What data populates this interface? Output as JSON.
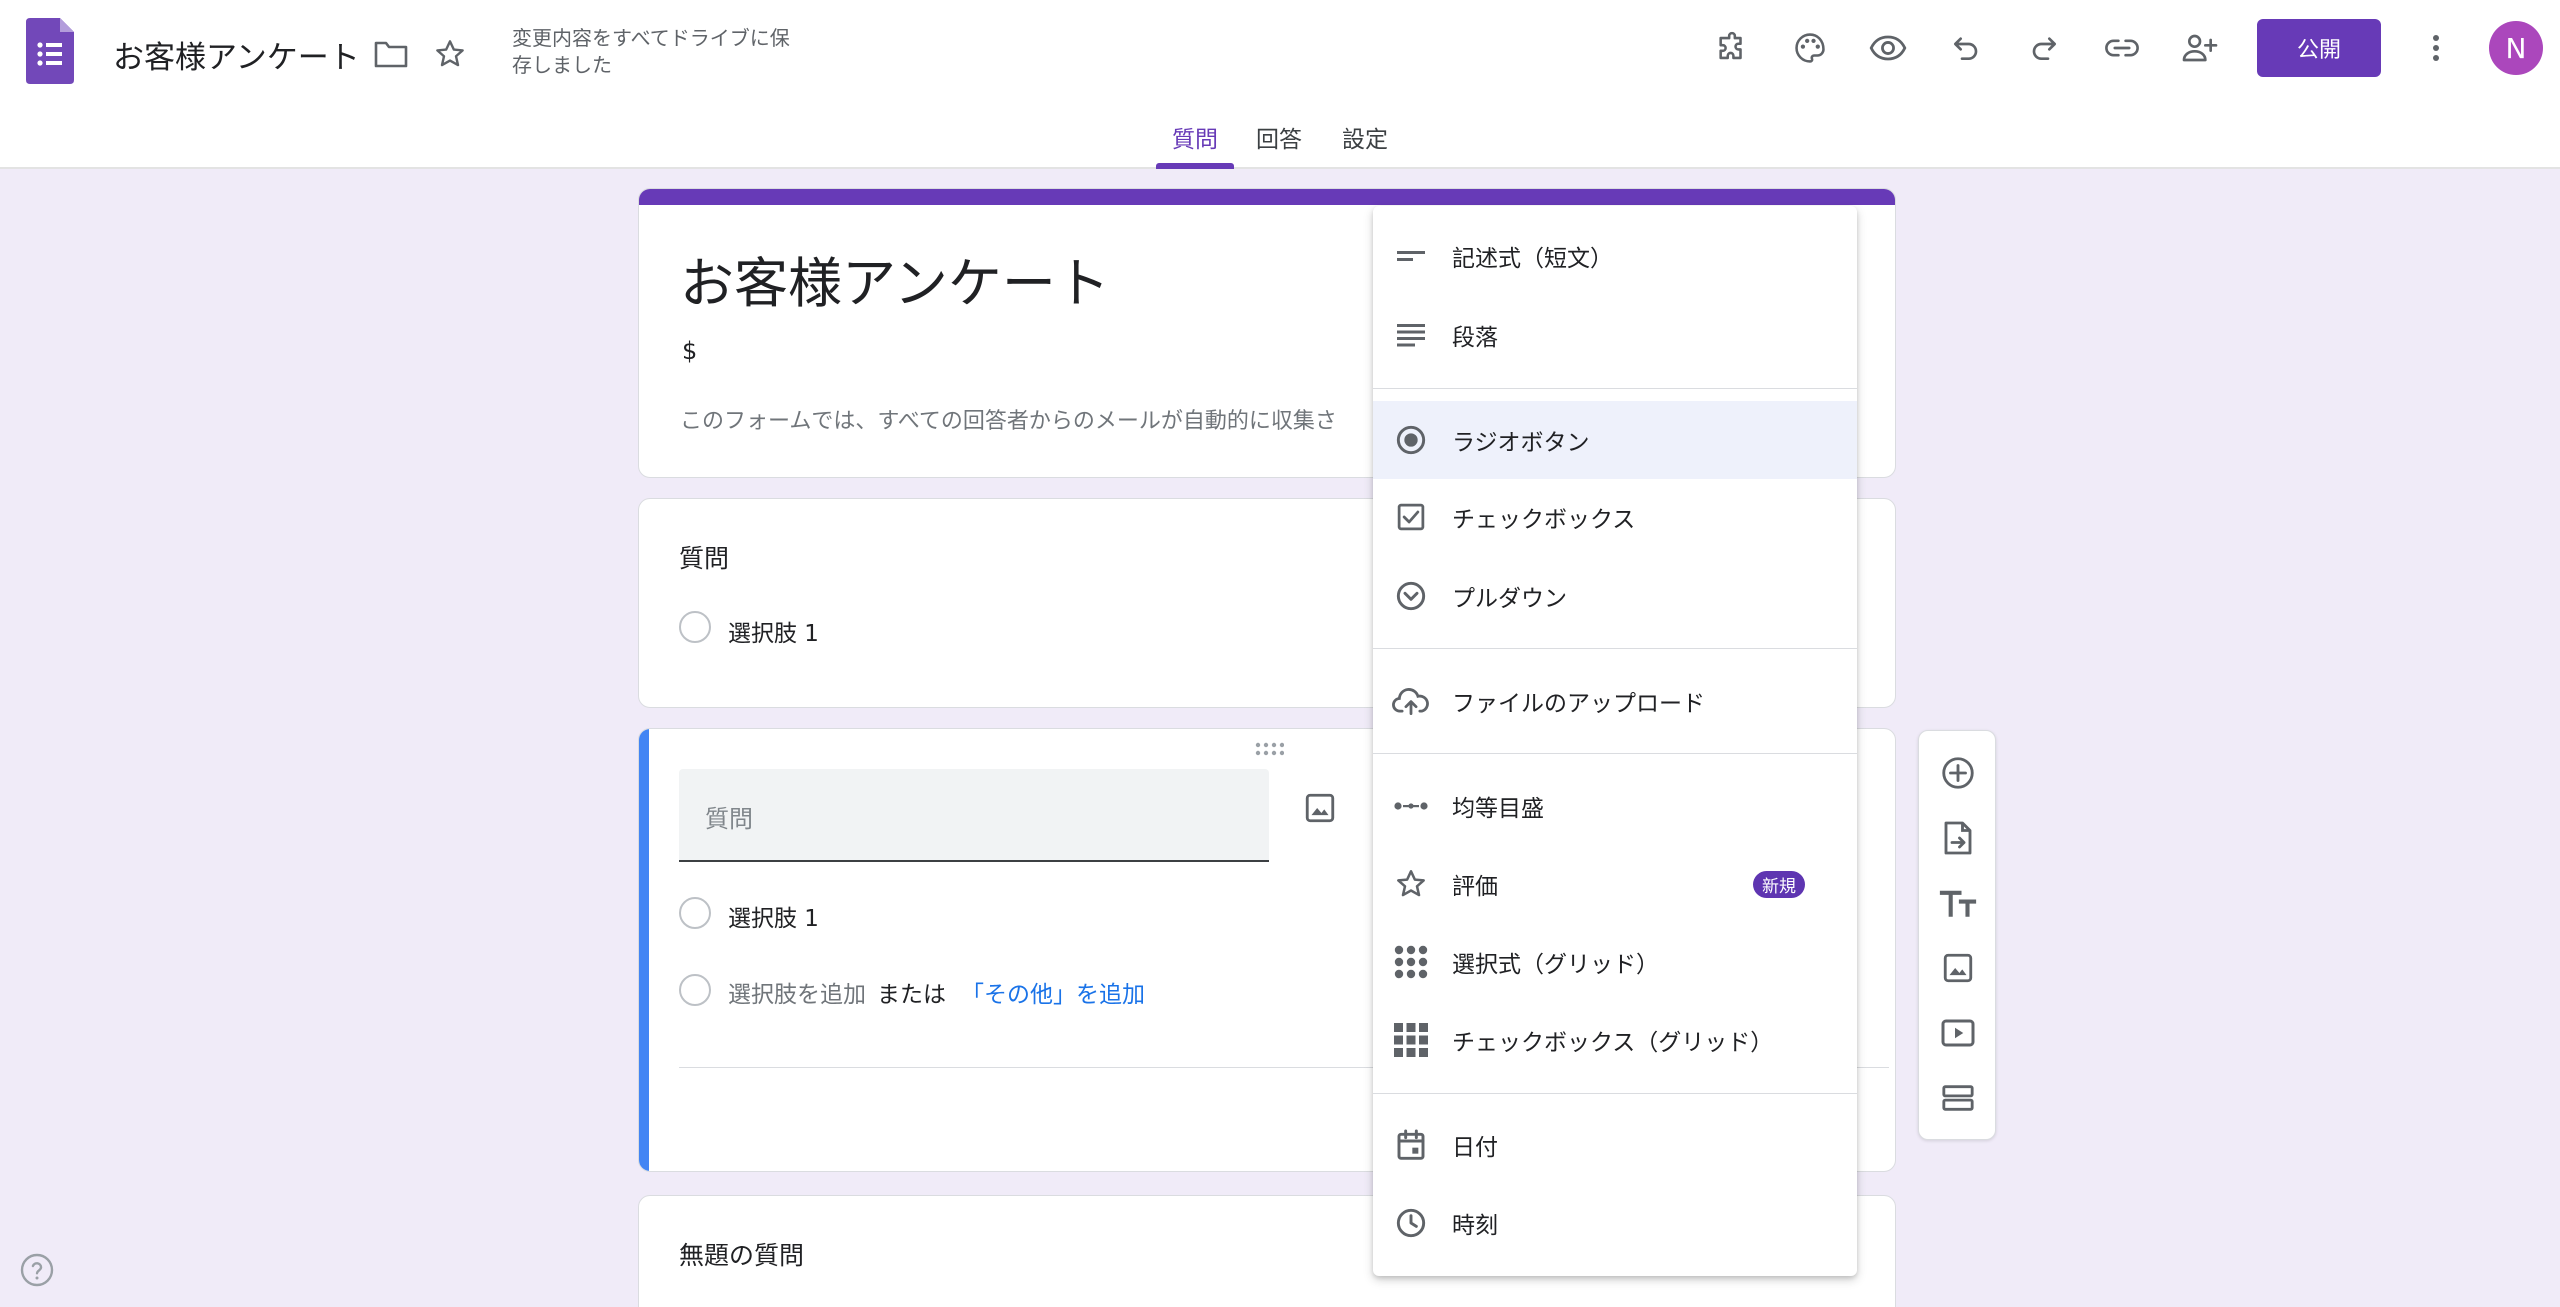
{
  "header": {
    "doc_title": "お客様アンケート",
    "save_status": "変更内容をすべてドライブに保存しました",
    "publish_label": "公開",
    "avatar_letter": "N",
    "tabs": [
      "質問",
      "回答",
      "設定"
    ],
    "active_tab": "質問",
    "icons": [
      "addon-icon",
      "palette-icon",
      "preview-eye-icon",
      "undo-icon",
      "redo-icon",
      "link-icon",
      "add-collaborator-icon",
      "more-vert-icon"
    ]
  },
  "form": {
    "title": "お客様アンケート",
    "description": "$",
    "email_notice": "このフォームでは、すべての回答者からのメールが自動的に収集さ"
  },
  "question1": {
    "title": "質問",
    "option1": "選択肢 1"
  },
  "question2": {
    "title_placeholder": "質問",
    "option1": "選択肢 1",
    "add_option": "選択肢を追加",
    "or_text": "または",
    "add_other": "「その他」を追加"
  },
  "question3": {
    "title": "無題の質問"
  },
  "type_menu": {
    "selected": "ラジオボタン",
    "items": [
      {
        "label": "記述式（短文）",
        "icon": "short-answer-icon"
      },
      {
        "label": "段落",
        "icon": "paragraph-icon"
      },
      {
        "label": "ラジオボタン",
        "icon": "radio-button-icon"
      },
      {
        "label": "チェックボックス",
        "icon": "checkbox-icon"
      },
      {
        "label": "プルダウン",
        "icon": "dropdown-icon"
      },
      {
        "label": "ファイルのアップロード",
        "icon": "cloud-upload-icon"
      },
      {
        "label": "均等目盛",
        "icon": "linear-scale-icon"
      },
      {
        "label": "評価",
        "icon": "star-icon",
        "badge": "新規"
      },
      {
        "label": "選択式（グリッド）",
        "icon": "dot-grid-icon"
      },
      {
        "label": "チェックボックス（グリッド）",
        "icon": "checkbox-grid-icon"
      },
      {
        "label": "日付",
        "icon": "calendar-icon"
      },
      {
        "label": "時刻",
        "icon": "clock-icon"
      }
    ]
  },
  "side_toolbar": [
    "add-question-icon",
    "import-questions-icon",
    "add-title-icon",
    "add-image-icon",
    "add-video-icon",
    "add-section-icon"
  ],
  "colors": {
    "accent": "#673ab7",
    "background": "#f0ebf8",
    "active_card_bar": "#4285f4",
    "link": "#1a73e8"
  }
}
